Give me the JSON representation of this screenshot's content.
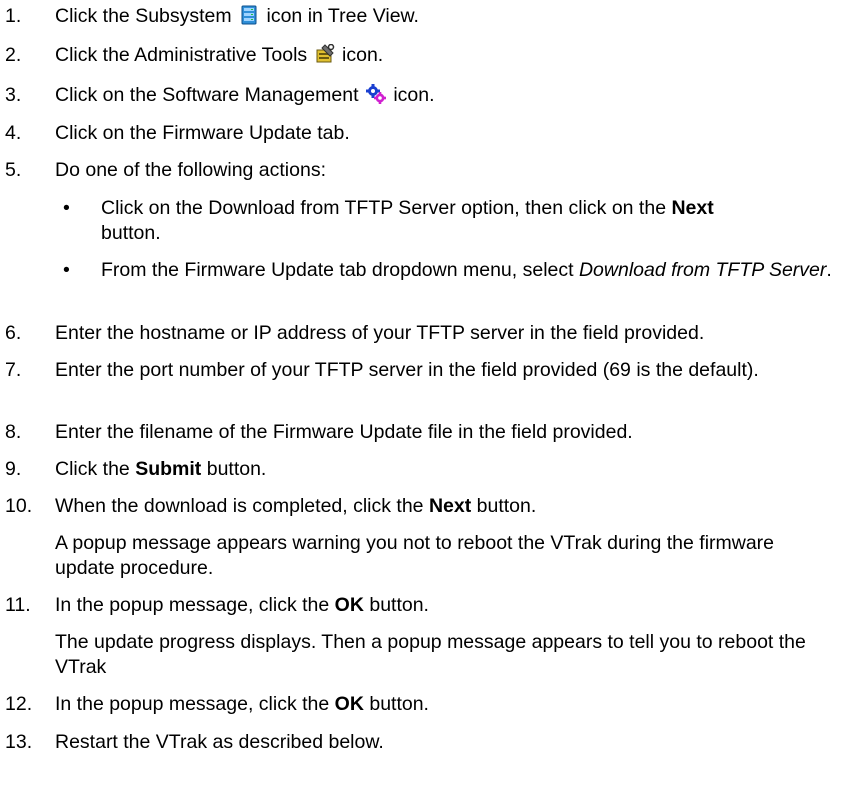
{
  "steps": {
    "s1": {
      "num": "1.",
      "a": "Click the Subsystem",
      "b": "icon in Tree View."
    },
    "s2": {
      "num": "2.",
      "a": "Click the Administrative Tools",
      "b": "icon."
    },
    "s3": {
      "num": "3.",
      "a": "Click on the Software Management",
      "b": "icon."
    },
    "s4": {
      "num": "4.",
      "a": "Click on the Firmware Update tab."
    },
    "s5": {
      "num": "5.",
      "a": "Do one of the following actions:"
    },
    "b1": {
      "bullet": "•",
      "a": "Click on the Download from TFTP Server option, then click on the",
      "bold": "Next",
      "b": "button."
    },
    "b2": {
      "bullet": "•",
      "a": "From the Firmware Update tab dropdown menu, select",
      "italic": "Download from TFTP Server",
      "b": "."
    },
    "s6": {
      "num": "6.",
      "a": "Enter the hostname or IP address of your TFTP server in the field provided."
    },
    "s7": {
      "num": "7.",
      "a": "Enter the port number of your TFTP server in the field provided (69 is the default)."
    },
    "s8": {
      "num": "8.",
      "a": "Enter the filename of the Firmware Update file in the field provided."
    },
    "s9": {
      "num": "9.",
      "a": "Click the",
      "bold": "Submit",
      "b": "button."
    },
    "s10": {
      "num": "10.",
      "a": "When the download is completed, click the",
      "bold": "Next",
      "b": "button.",
      "note": "A popup message appears warning you not to reboot the VTrak during the firmware update procedure."
    },
    "s11": {
      "num": "11.",
      "a": "In the popup message, click the",
      "bold": "OK",
      "b": "button.",
      "note": "The update progress displays. Then a popup message appears to tell you to reboot the VTrak"
    },
    "s12": {
      "num": "12.",
      "a": "In the popup message, click the",
      "bold": "OK",
      "b": "button."
    },
    "s13": {
      "num": "13.",
      "a": "Restart the VTrak as described below."
    }
  },
  "icons": {
    "subsystem": "subsystem-icon",
    "admin_tools": "administrative-tools-icon",
    "software_mgmt": "software-management-icon"
  },
  "colors": {
    "subsystem_icon": "#2f8fd8",
    "admin_icon": "#e0c030",
    "gear_blue": "#1a3fd0",
    "gear_magenta": "#d020d0"
  }
}
